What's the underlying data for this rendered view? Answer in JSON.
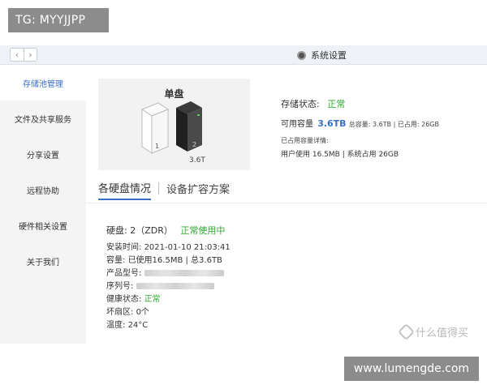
{
  "watermark_top": "TG: MYYJJPP",
  "watermark_bottom": "www.lumengde.com",
  "watermark_site": "什么值得买",
  "window": {
    "title": "系统设置",
    "nav_back": "‹",
    "nav_forward": "›"
  },
  "sidebar": {
    "items": [
      {
        "label": "存储池管理",
        "active": true
      },
      {
        "label": "文件及共享服务"
      },
      {
        "label": "分享设置"
      },
      {
        "label": "远程协助"
      },
      {
        "label": "硬件相关设置"
      },
      {
        "label": "关于我们"
      }
    ]
  },
  "drive": {
    "title": "单盘",
    "slot1": "1",
    "slot2": "2",
    "capacity": "3.6T"
  },
  "storage": {
    "status_label": "存储状态:",
    "status_value": "正常",
    "avail_label": "可用容量",
    "avail_value": "3.6TB",
    "total_text": "总容量: 3.6TB | 已占用: 26GB",
    "detail_label": "已占用容量详情:",
    "detail_value": "用户使用 16.5MB | 系统占用 26GB"
  },
  "tabs": [
    {
      "label": "各硬盘情况",
      "active": true
    },
    {
      "label": "设备扩容方案"
    }
  ],
  "disk": {
    "head": "硬盘: 2（ZDR）",
    "head_status": "正常使用中",
    "install_label": "安装时间:",
    "install_value": "2021-01-10 21:03:41",
    "capacity_label": "容量:",
    "capacity_value": "已使用16.5MB | 总3.6TB",
    "model_label": "产品型号:",
    "serial_label": "序列号:",
    "health_label": "健康状态:",
    "health_value": "正常",
    "bad_label": "坏扇区:",
    "bad_value": "0个",
    "temp_label": "温度:",
    "temp_value": "24°C"
  },
  "colors": {
    "accent": "#3a6fc4",
    "ok": "#2fa82f",
    "sidebar_bg": "#f4f4f4",
    "card_bg": "#f2f2f2"
  }
}
